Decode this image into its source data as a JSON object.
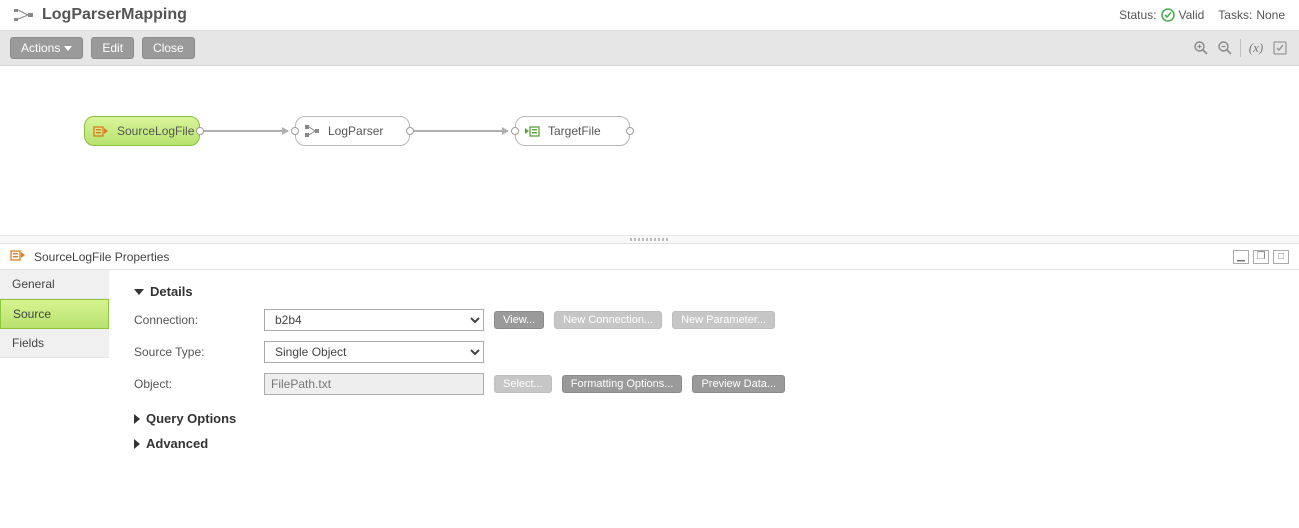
{
  "header": {
    "title": "LogParserMapping",
    "status_label": "Status:",
    "status_value": "Valid",
    "tasks_label": "Tasks:",
    "tasks_value": "None"
  },
  "toolbar": {
    "actions_label": "Actions",
    "edit_label": "Edit",
    "close_label": "Close"
  },
  "canvas": {
    "nodes": [
      {
        "name": "SourceLogFile"
      },
      {
        "name": "LogParser"
      },
      {
        "name": "TargetFile"
      }
    ]
  },
  "properties": {
    "panel_title": "SourceLogFile Properties",
    "tabs": [
      "General",
      "Source",
      "Fields"
    ],
    "active_tab": "Source",
    "details_label": "Details",
    "connection_label": "Connection:",
    "connection_value": "b2b4",
    "source_type_label": "Source Type:",
    "source_type_value": "Single Object",
    "object_label": "Object:",
    "object_value": "FilePath.txt",
    "buttons": {
      "view": "View...",
      "new_connection": "New Connection...",
      "new_parameter": "New Parameter...",
      "select": "Select...",
      "formatting": "Formatting Options...",
      "preview": "Preview Data..."
    },
    "query_options_label": "Query Options",
    "advanced_label": "Advanced"
  }
}
